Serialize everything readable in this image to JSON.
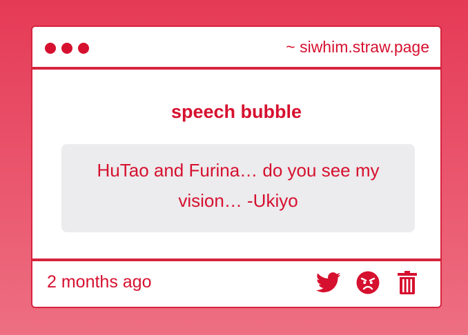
{
  "window": {
    "url": "~ siwhim.straw.page"
  },
  "post": {
    "title": "speech bubble",
    "message": "HuTao and Furina… do you see my vision… -Ukiyo",
    "time_ago": "2 months ago"
  },
  "actions": [
    {
      "icon": "twitter-bird-icon"
    },
    {
      "icon": "angry-face-icon"
    },
    {
      "icon": "trash-icon"
    }
  ],
  "colors": {
    "accent": "#d6102f",
    "border": "#d6243d",
    "bubble_bg": "#ecebed",
    "background_top": "#e53a56",
    "background_bottom": "#ee6f82"
  }
}
